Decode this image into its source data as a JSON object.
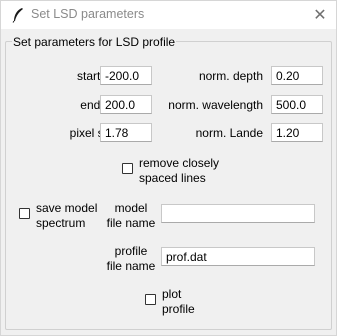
{
  "window": {
    "title": "Set LSD parameters",
    "close_glyph": "✕"
  },
  "group": {
    "label": "Set parameters for LSD profile"
  },
  "params": {
    "start_vel": {
      "label": "start vel",
      "value": "-200.0"
    },
    "end_vel": {
      "label": "end vel",
      "value": "200.0"
    },
    "pixel_size": {
      "label": "pixel size",
      "value": "1.78"
    },
    "norm_depth": {
      "label": "norm. depth",
      "value": "0.20"
    },
    "norm_wavelength": {
      "label": "norm. wavelength",
      "value": "500.0"
    },
    "norm_lande": {
      "label": "norm. Lande",
      "value": "1.20"
    }
  },
  "options": {
    "remove_close_lines": {
      "label_line1": "remove closely",
      "label_line2": "spaced lines",
      "checked": false
    },
    "save_model": {
      "label_line1": "save model",
      "label_line2": "spectrum",
      "checked": false
    },
    "plot_profile": {
      "label_line1": "plot",
      "label_line2": "profile",
      "checked": false
    }
  },
  "files": {
    "model": {
      "label_line1": "model",
      "label_line2": "file name",
      "value": ""
    },
    "profile": {
      "label_line1": "profile",
      "label_line2": "file name",
      "value": "prof.dat"
    }
  },
  "icons": {
    "title": "feather-icon",
    "close": "close-icon"
  }
}
